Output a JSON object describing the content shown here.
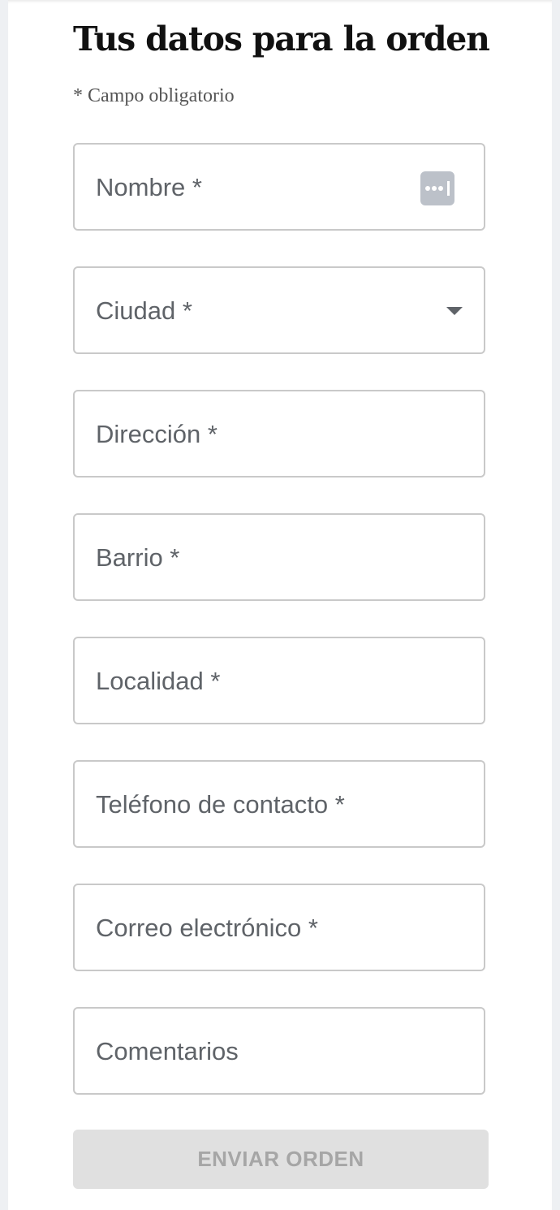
{
  "form": {
    "title": "Tus datos para la orden",
    "required_note": "* Campo obligatorio",
    "fields": [
      {
        "label": "Nombre *",
        "icon": "password-key-icon"
      },
      {
        "label": "Ciudad *",
        "icon": "chevron-down-icon",
        "type": "select"
      },
      {
        "label": "Dirección *"
      },
      {
        "label": "Barrio *"
      },
      {
        "label": "Localidad *"
      },
      {
        "label": "Teléfono de contacto *"
      },
      {
        "label": "Correo electrónico *"
      },
      {
        "label": "Comentarios"
      }
    ],
    "submit_label": "ENVIAR ORDEN"
  },
  "colors": {
    "field_border": "#c9c9c9",
    "label_text": "#5f6368",
    "button_disabled_bg": "#e0e0e0",
    "button_disabled_text": "#a6a6a6"
  }
}
